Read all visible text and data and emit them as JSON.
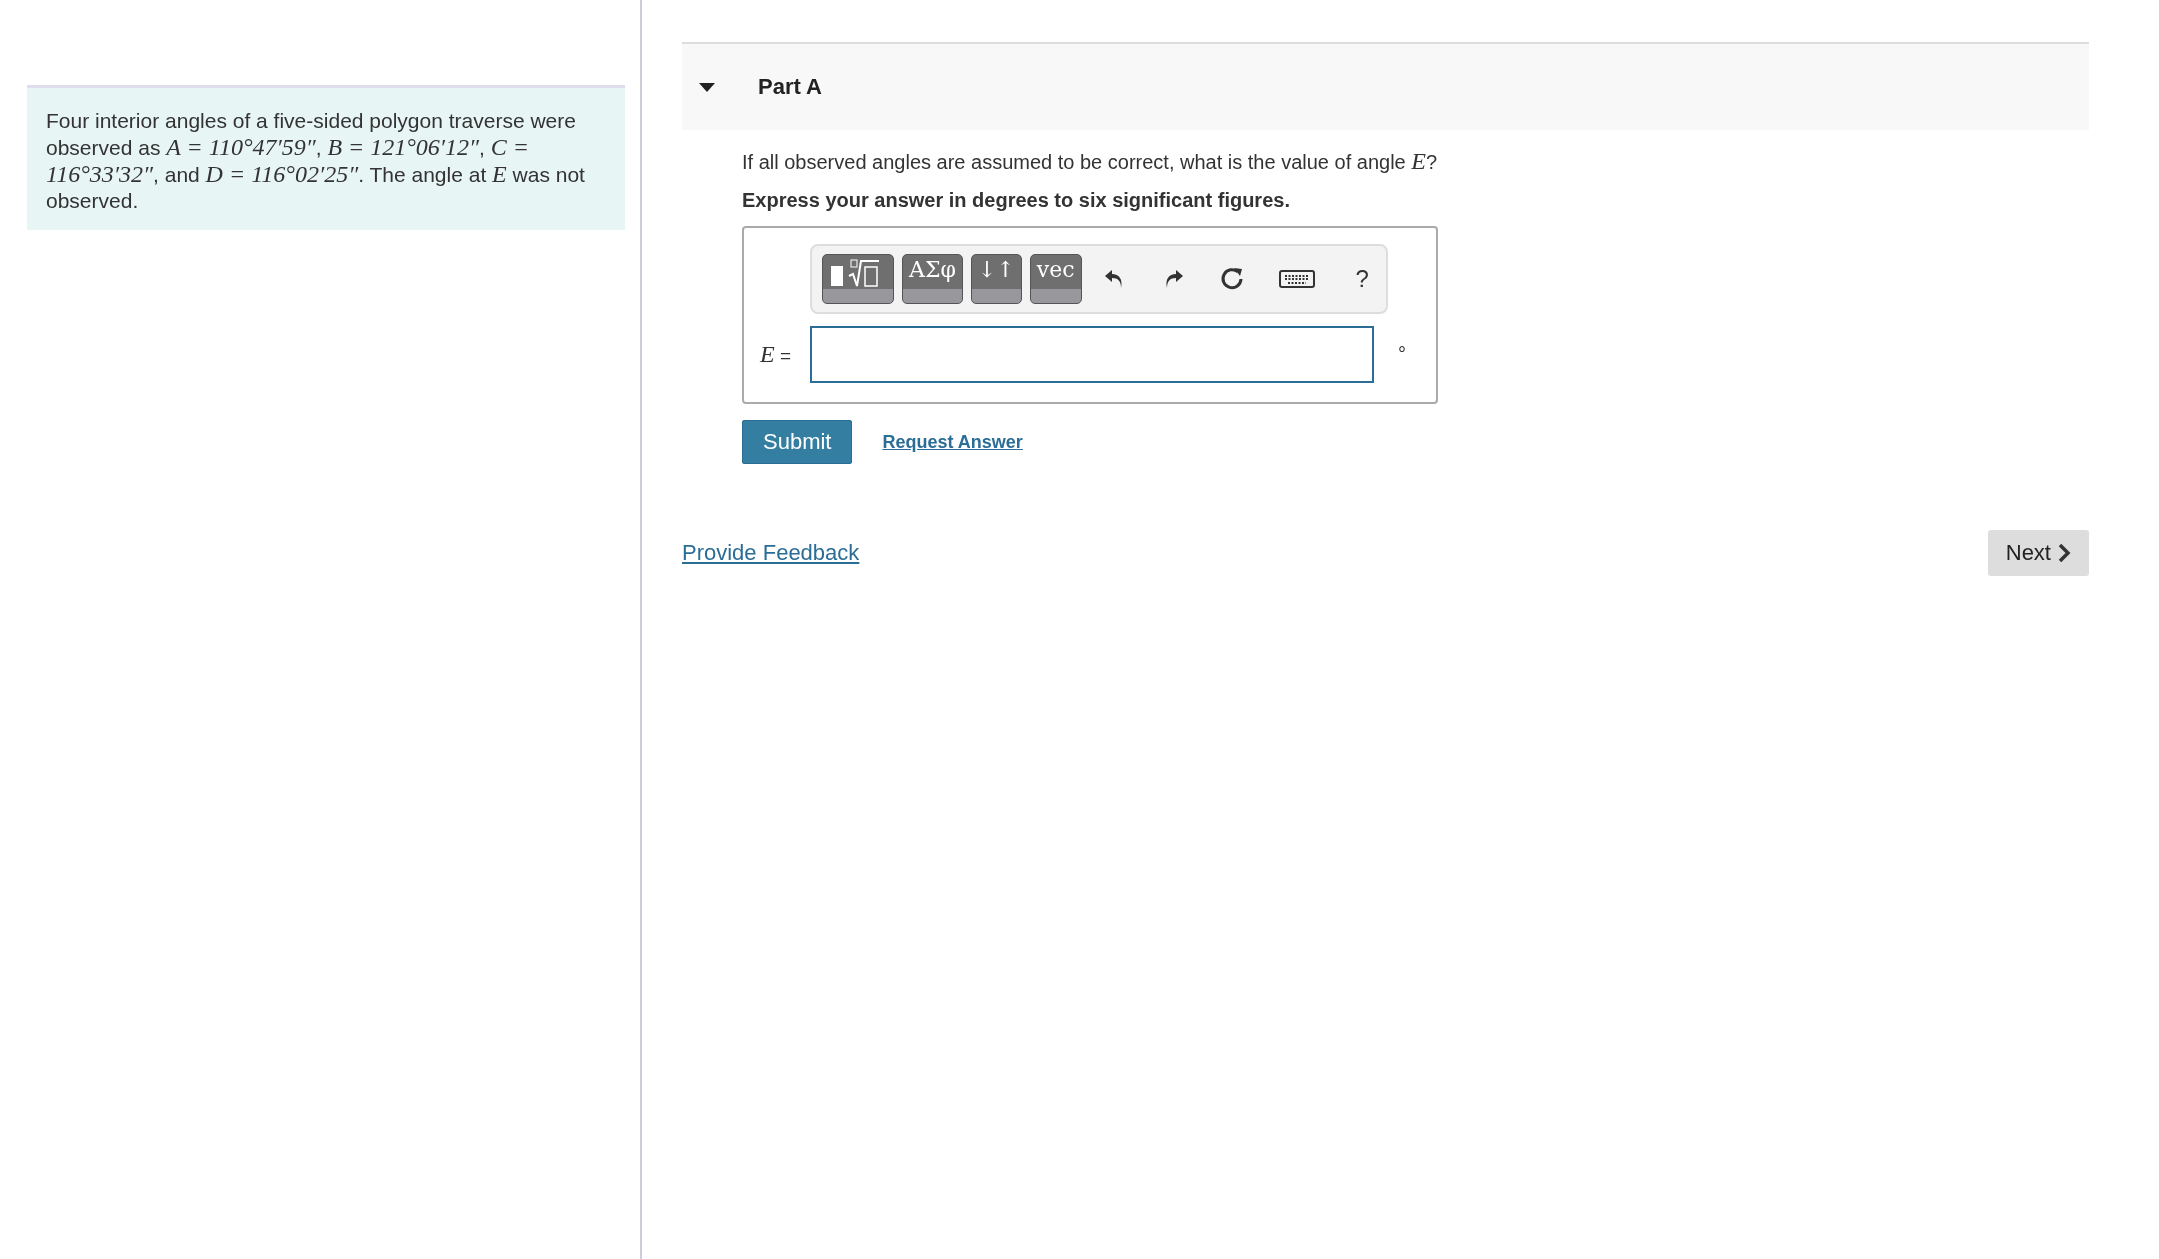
{
  "problem": {
    "segments": [
      {
        "kind": "text",
        "text": "Four interior angles of a five-sided polygon traverse were observed as "
      },
      {
        "kind": "math",
        "text": "A = 110°47′59″"
      },
      {
        "kind": "text",
        "text": ", "
      },
      {
        "kind": "math",
        "text": "B = 121°06′12″"
      },
      {
        "kind": "text",
        "text": ", "
      },
      {
        "kind": "math",
        "text": "C = 116°33′32″"
      },
      {
        "kind": "text",
        "text": ", and "
      },
      {
        "kind": "math",
        "text": "D = 116°02′25″"
      },
      {
        "kind": "text",
        "text": ". The angle at "
      },
      {
        "kind": "math",
        "text": "E"
      },
      {
        "kind": "text",
        "text": " was not observed."
      }
    ]
  },
  "part": {
    "title": "Part A",
    "expanded": true,
    "question": [
      {
        "kind": "text",
        "text": "If all observed angles are assumed to be correct, what is the value of angle "
      },
      {
        "kind": "math",
        "text": "E"
      },
      {
        "kind": "text",
        "text": "?"
      }
    ],
    "instruction": "Express your answer in degrees to six significant figures.",
    "toolbar": [
      {
        "kind": "templates"
      },
      {
        "kind": "label",
        "text": "ΑΣφ"
      },
      {
        "kind": "label",
        "text": "↓↑"
      },
      {
        "kind": "label",
        "text": "vec"
      },
      {
        "kind": "undo"
      },
      {
        "kind": "redo"
      },
      {
        "kind": "reset"
      },
      {
        "kind": "keyboard"
      },
      {
        "kind": "help",
        "text": "?"
      }
    ],
    "answer": {
      "variable": "E",
      "equals": "=",
      "unit": "°"
    },
    "buttons": {
      "submit": "Submit",
      "request": "Request Answer"
    }
  },
  "footer": {
    "feedback": "Provide Feedback",
    "next": "Next"
  }
}
